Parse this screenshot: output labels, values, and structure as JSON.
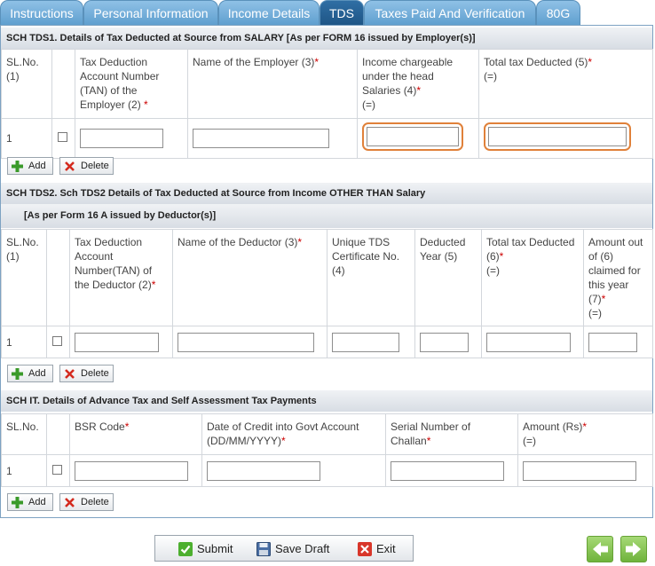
{
  "tabs": [
    {
      "label": "Instructions",
      "active": false
    },
    {
      "label": "Personal Information",
      "active": false
    },
    {
      "label": "Income Details",
      "active": false
    },
    {
      "label": "TDS",
      "active": true
    },
    {
      "label": "Taxes Paid And Verification",
      "active": false
    },
    {
      "label": "80G",
      "active": false
    }
  ],
  "tds1": {
    "title": "SCH TDS1. Details of Tax Deducted at Source from SALARY [As per FORM 16 issued by Employer(s)]",
    "col_slno": "SL.No.",
    "col_slno_sub": "(1)",
    "col_tan": "Tax Deduction Account Number (TAN) of the Employer (2)",
    "col_employer": "Name of the Employer (3)",
    "col_income": "Income chargeable under the head Salaries (4)",
    "col_income_sub": "(=)",
    "col_tax": "Total tax Deducted (5)",
    "col_tax_sub": "(=)",
    "row_no": "1",
    "required_mark": "*"
  },
  "tds2": {
    "title": "SCH TDS2. Sch TDS2 Details of Tax Deducted at Source from Income OTHER THAN Salary",
    "subtitle": "[As per Form 16 A issued by Deductor(s)]",
    "col_slno": "SL.No.",
    "col_slno_sub": "(1)",
    "col_tan": "Tax Deduction Account Number(TAN) of the Deductor (2)",
    "col_deductor": "Name of the Deductor (3)",
    "col_cert": "Unique TDS Certificate No.",
    "col_cert_sub": "(4)",
    "col_year": "Deducted Year (5)",
    "col_tax": "Total tax Deducted (6)",
    "col_tax_sub": "(=)",
    "col_claimed": "Amount out of (6) claimed for this year (7)",
    "col_claimed_sub": "(=)",
    "row_no": "1",
    "required_mark": "*"
  },
  "schit": {
    "title": "SCH IT. Details of Advance Tax and Self Assessment Tax Payments",
    "col_slno": "SL.No.",
    "col_bsr": "BSR Code",
    "col_date": "Date of Credit into Govt Account (DD/MM/YYYY)",
    "col_serial": "Serial Number of Challan",
    "col_amount": "Amount (Rs)",
    "col_amount_sub": "(=)",
    "row_no": "1",
    "required_mark": "*"
  },
  "row_buttons": {
    "add": "Add",
    "delete": "Delete"
  },
  "actions": {
    "submit": "Submit",
    "save_draft": "Save Draft",
    "exit": "Exit"
  },
  "colors": {
    "tab": "#6fa9d6",
    "tab_active": "#275f92",
    "highlight": "#e0813a",
    "nav": "#7fbf4a",
    "required": "#cc0000"
  }
}
